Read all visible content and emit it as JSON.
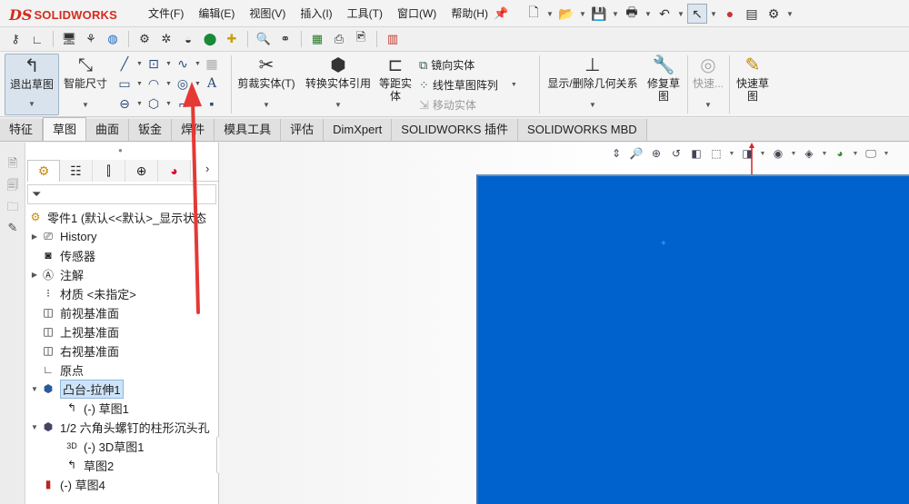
{
  "app": {
    "logo_ds": "DS",
    "logo_name": "SOLIDWORKS"
  },
  "menu": [
    "文件(F)",
    "编辑(E)",
    "视图(V)",
    "插入(I)",
    "工具(T)",
    "窗口(W)",
    "帮助(H)"
  ],
  "ribbon": {
    "exit_sketch": "退出草图",
    "smart_dimension": "智能尺寸",
    "trim": "剪裁实体(T)",
    "convert": "转换实体引用",
    "offset_line1": "等距实",
    "offset_line2": "体",
    "mirror": "镜向实体",
    "linear_pattern": "线性草图阵列",
    "move": "移动实体",
    "relations": "显示/删除几何关系",
    "repair_line1": "修复草",
    "repair_line2": "图",
    "quick_snaps": "快速...",
    "rapid_line1": "快速草",
    "rapid_line2": "图"
  },
  "tabs": [
    "特征",
    "草图",
    "曲面",
    "钣金",
    "焊件",
    "模具工具",
    "评估",
    "DimXpert",
    "SOLIDWORKS 插件",
    "SOLIDWORKS MBD"
  ],
  "active_tab": "草图",
  "tree": {
    "root": "零件1  (默认<<默认>_显示状态",
    "history": "History",
    "sensors": "传感器",
    "annotations": "注解",
    "material": "材质 <未指定>",
    "front_plane": "前视基准面",
    "top_plane": "上视基准面",
    "right_plane": "右视基准面",
    "origin": "原点",
    "boss_extrude": "凸台-拉伸1",
    "sketch1": "(-) 草图1",
    "hole": "1/2 六角头螺钉的柱形沉头孔",
    "sketch3d": "(-) 3D草图1",
    "sketch2": "草图2",
    "sketch4": "(-) 草图4"
  },
  "icons": {
    "filter": "funnel-icon",
    "annotation_arrow_color": "#e53935"
  },
  "colors": {
    "face_blue": "#0062cc",
    "logo_red": "#d52b1e",
    "selection": "#cde3f7"
  }
}
